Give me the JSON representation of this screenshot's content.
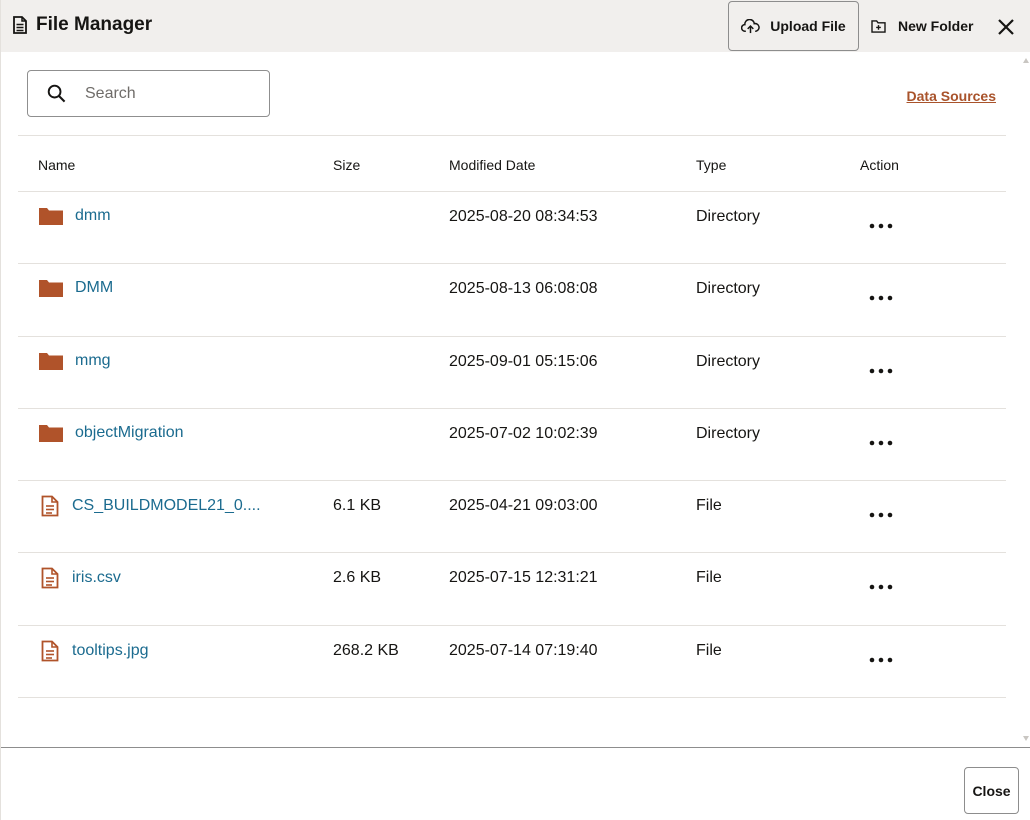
{
  "header": {
    "title": "File Manager",
    "title_icon": "document-icon",
    "upload_label": "Upload File",
    "upload_icon": "cloud-upload-icon",
    "new_folder_label": "New Folder",
    "new_folder_icon": "add-folder-icon",
    "close_icon": "close-icon"
  },
  "search": {
    "placeholder": "Search",
    "value": ""
  },
  "data_sources_label": "Data Sources",
  "table": {
    "columns": [
      "Name",
      "Size",
      "Modified Date",
      "Type",
      "Action"
    ],
    "rows": [
      {
        "name": "dmm",
        "icon": "folder-icon",
        "size": "",
        "modified": "2025-08-20 08:34:53",
        "type": "Directory",
        "action": "..."
      },
      {
        "name": "DMM",
        "icon": "folder-icon",
        "size": "",
        "modified": "2025-08-13 06:08:08",
        "type": "Directory",
        "action": "..."
      },
      {
        "name": "mmg",
        "icon": "folder-icon",
        "size": "",
        "modified": "2025-09-01 05:15:06",
        "type": "Directory",
        "action": "..."
      },
      {
        "name": "objectMigration",
        "icon": "folder-icon",
        "size": "",
        "modified": "2025-07-02 10:02:39",
        "type": "Directory",
        "action": "..."
      },
      {
        "name": "CS_BUILDMODEL21_0....",
        "icon": "file-icon",
        "size": "6.1 KB",
        "modified": "2025-04-21 09:03:00",
        "type": "File",
        "action": "..."
      },
      {
        "name": "iris.csv",
        "icon": "file-icon",
        "size": "2.6 KB",
        "modified": "2025-07-15 12:31:21",
        "type": "File",
        "action": "..."
      },
      {
        "name": "tooltips.jpg",
        "icon": "file-icon",
        "size": "268.2 KB",
        "modified": "2025-07-14 07:19:40",
        "type": "File",
        "action": "..."
      }
    ]
  },
  "footer": {
    "close_label": "Close"
  },
  "colors": {
    "header_bg": "#f1efed",
    "link": "#1b6b8f",
    "accent": "#a9532b",
    "folder": "#b0532a",
    "divider": "#e4e1dd"
  }
}
